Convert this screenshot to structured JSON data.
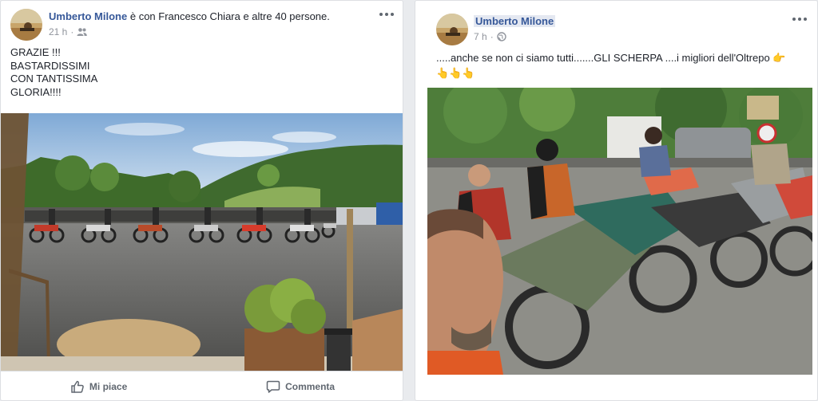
{
  "post1": {
    "author": "Umberto Milone",
    "headline_suffix": " è con Francesco Chiara e altre 40 persone.",
    "time": "21 h",
    "audience_separator": "·",
    "lines": [
      "GRAZIE !!!",
      "BASTARDISSIMI",
      "CON TANTISSIMA",
      "GLORIA!!!!"
    ],
    "actions": {
      "like": "Mi piace",
      "comment": "Commenta"
    }
  },
  "post2": {
    "author": "Umberto Milone",
    "time": "7 h",
    "audience_separator": "·",
    "text": ".....anche se non ci siamo tutti.......GLI SCHERPA ....i migliori dell'Oltrepo",
    "hand_emoji": "👉",
    "hand_up_emoji": "👆"
  },
  "icons": {
    "friends": "friends-icon",
    "globe": "globe-icon",
    "like": "thumbs-up-icon",
    "comment": "comment-icon",
    "more": "more-options-icon"
  }
}
